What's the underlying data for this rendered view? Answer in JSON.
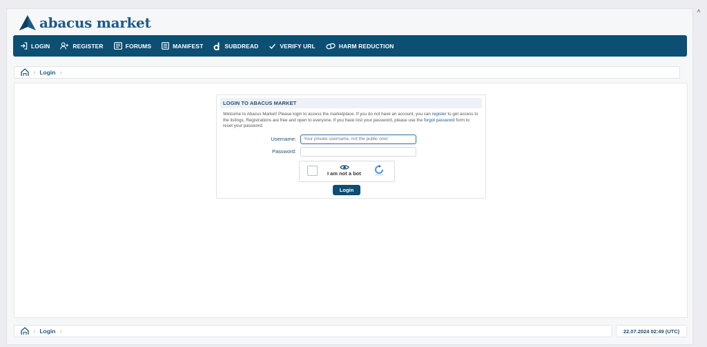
{
  "brand": {
    "name": "abacus market",
    "color": "#1d5a88",
    "nav_color": "#0d4e73"
  },
  "nav": {
    "items": [
      {
        "label": "LOGIN",
        "icon": "login-icon"
      },
      {
        "label": "REGISTER",
        "icon": "user-add-icon"
      },
      {
        "label": "FORUMS",
        "icon": "forum-icon"
      },
      {
        "label": "MANIFEST",
        "icon": "document-icon"
      },
      {
        "label": "SUBDREAD",
        "icon": "dread-icon"
      },
      {
        "label": "VERIFY URL",
        "icon": "check-icon"
      },
      {
        "label": "HARM REDUCTION",
        "icon": "pill-icon"
      }
    ]
  },
  "breadcrumb": {
    "current": "Login"
  },
  "login": {
    "heading": "LOGIN TO ABACUS MARKET",
    "intro_1": "Welcome to Abacus Market! Please login to access the marketplace. If you do not have an account, you can ",
    "intro_register": "register",
    "intro_2": " to get access to the listings. Registrations are free and open to everyone. If you have lost your password, please use the ",
    "intro_forgot": "forgot password",
    "intro_3": " form to reset your password.",
    "username_label": "Username:",
    "username_placeholder": "Your private username, not the public one!",
    "password_label": "Password:",
    "captcha_label": "I am not a bot",
    "submit_label": "Login"
  },
  "footer": {
    "crumb": "Login",
    "timestamp": "22.07.2024 02:49 (UTC)"
  }
}
